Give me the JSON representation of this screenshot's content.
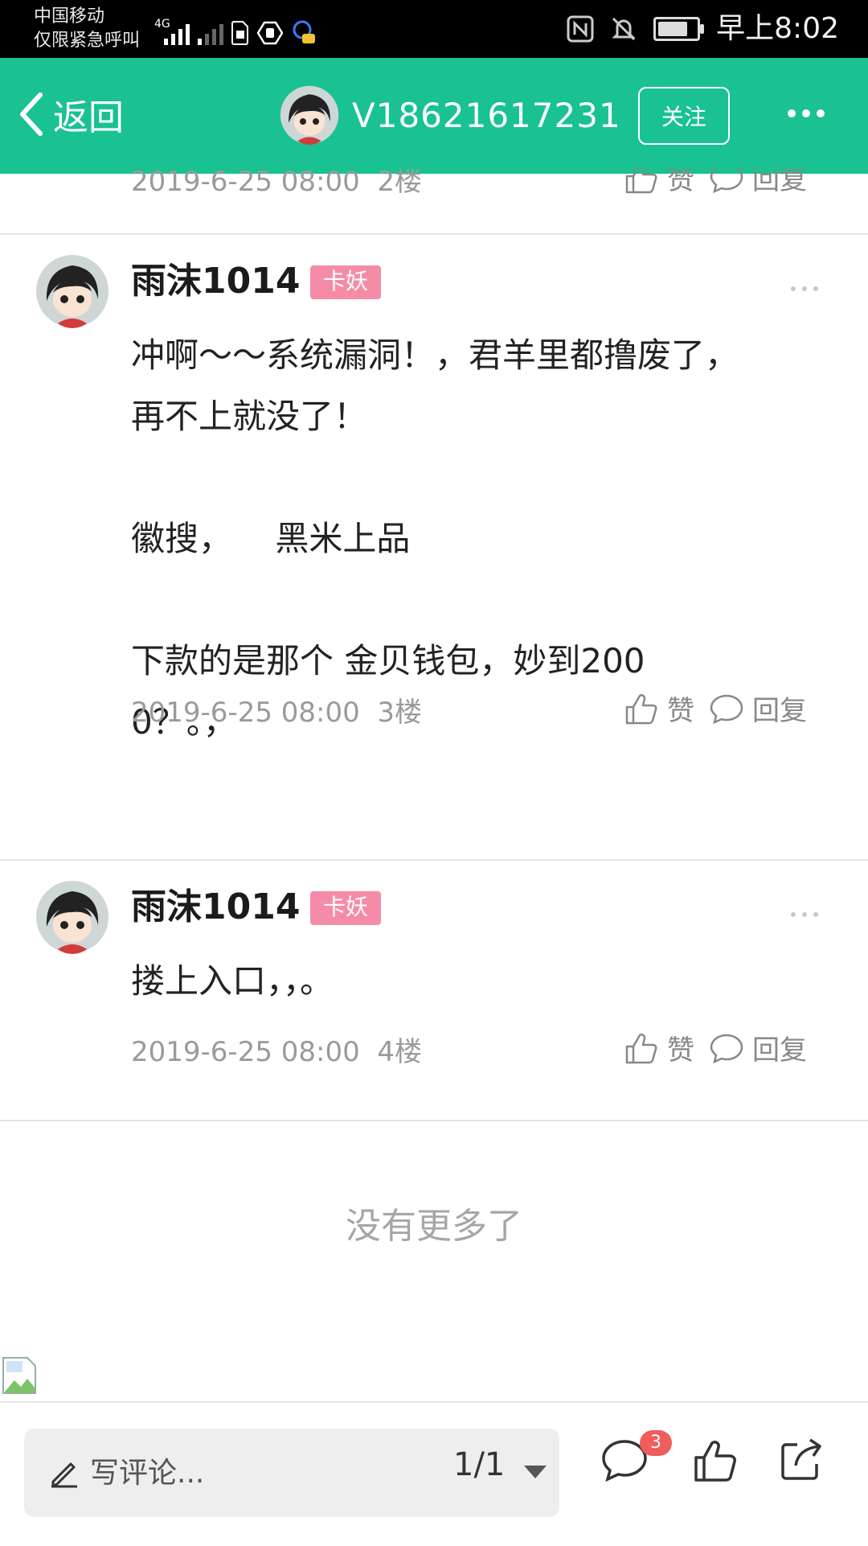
{
  "status_bar": {
    "carrier_line1": "中国移动",
    "carrier_line2": "仅限紧急呼叫",
    "network": "4G",
    "time": "早上8:02"
  },
  "header": {
    "back_label": "返回",
    "username": "V18621617231",
    "follow_label": "关注"
  },
  "previous_reply": {
    "date": "2019-6-25 08:00",
    "floor": "2楼",
    "like_label": "赞",
    "reply_label": "回复"
  },
  "replies": [
    {
      "name": "雨沫1014",
      "badge": "卡妖",
      "body": "冲啊～～系统漏洞！，君羊里都撸废了，\n再不上就没了！\n\n徽搜，    黑米上品\n\n下款的是那个 金贝钱包，妙到200\n0？。，",
      "date": "2019-6-25 08:00",
      "floor": "3楼",
      "like_label": "赞",
      "reply_label": "回复"
    },
    {
      "name": "雨沫1014",
      "badge": "卡妖",
      "body": "搂上入口，，。",
      "date": "2019-6-25 08:00",
      "floor": "4楼",
      "like_label": "赞",
      "reply_label": "回复"
    }
  ],
  "no_more_text": "没有更多了",
  "bottom_bar": {
    "comment_placeholder": "写评论...",
    "pager": "1/1",
    "comment_count": "3"
  },
  "colors": {
    "header_green": "#19c193",
    "badge_pink": "#f58ca7",
    "count_red": "#f25c5c"
  },
  "icons": [
    "chevron-left-icon",
    "more-icon",
    "like-icon",
    "comment-icon",
    "pen-icon",
    "caret-down-icon",
    "share-icon",
    "broken-image-icon"
  ]
}
